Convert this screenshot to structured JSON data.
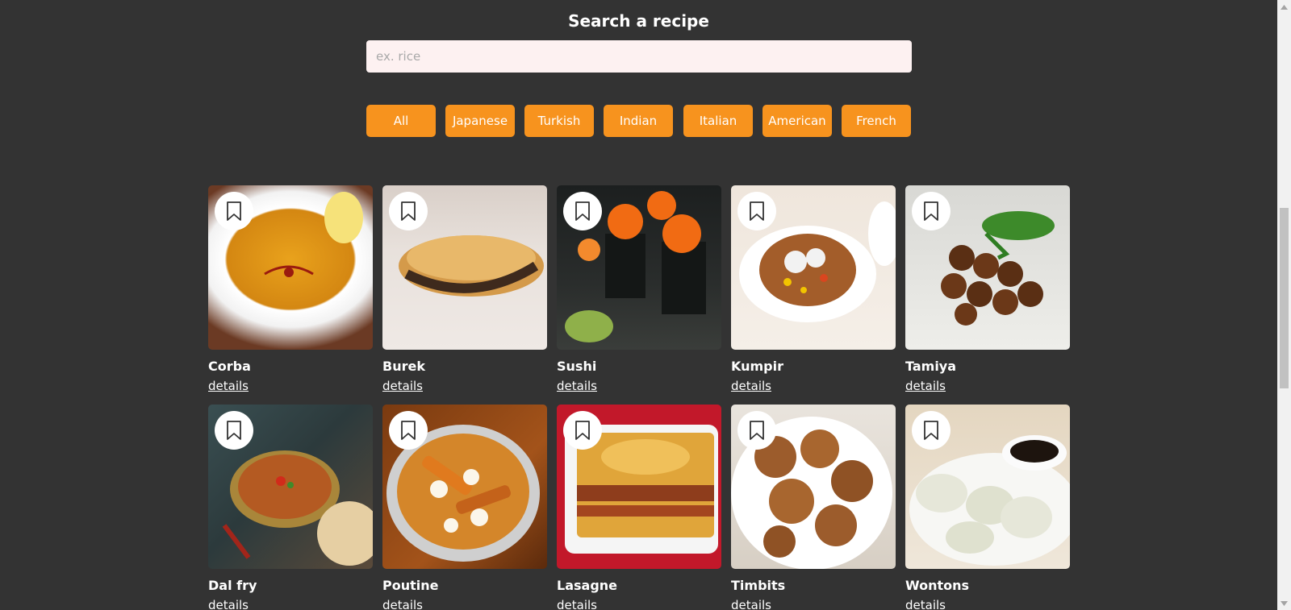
{
  "search": {
    "title": "Search a recipe",
    "placeholder": "ex. rice",
    "value": ""
  },
  "filters": [
    "All",
    "Japanese",
    "Turkish",
    "Indian",
    "Italian",
    "American",
    "French"
  ],
  "filter_color": "#f7931e",
  "background_color": "#333333",
  "recipes": [
    {
      "name": "Corba",
      "link": "details",
      "icon": "bookmark-icon"
    },
    {
      "name": "Burek",
      "link": "details",
      "icon": "bookmark-icon"
    },
    {
      "name": "Sushi",
      "link": "details",
      "icon": "bookmark-icon"
    },
    {
      "name": "Kumpir",
      "link": "details",
      "icon": "bookmark-icon"
    },
    {
      "name": "Tamiya",
      "link": "details",
      "icon": "bookmark-icon"
    },
    {
      "name": "Dal fry",
      "link": "details",
      "icon": "bookmark-icon"
    },
    {
      "name": "Poutine",
      "link": "details",
      "icon": "bookmark-icon"
    },
    {
      "name": "Lasagne",
      "link": "details",
      "icon": "bookmark-icon"
    },
    {
      "name": "Timbits",
      "link": "details",
      "icon": "bookmark-icon"
    },
    {
      "name": "Wontons",
      "link": "details",
      "icon": "bookmark-icon"
    }
  ]
}
